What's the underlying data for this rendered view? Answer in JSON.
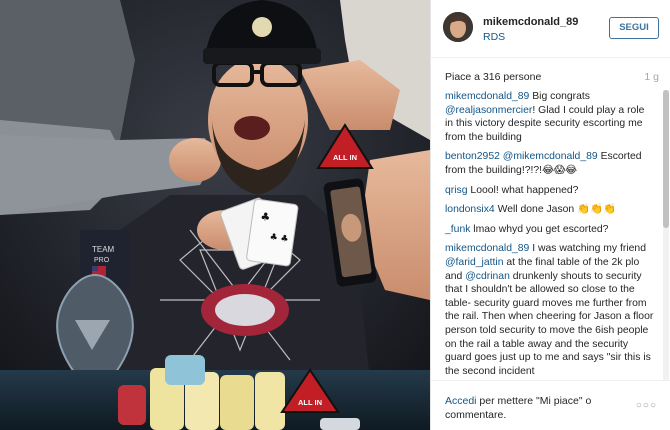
{
  "post": {
    "username": "mikemcdonald_89",
    "location": "RDS",
    "follow_label": "SEGUI",
    "likes_text": "Piace a 316 persone",
    "time_ago": "1 g",
    "photo_labels": {
      "all_in_1": "ALL IN",
      "all_in_2": "ALL IN",
      "team": "TEAM",
      "team_2": "PRO"
    }
  },
  "comments": [
    {
      "author": "mikemcdonald_89",
      "parts": [
        " Big congrats ",
        "@realjasonmercier",
        "! Glad I could play a role in this victory despite security escorting me from the building"
      ]
    },
    {
      "author": "benton2952",
      "parts": [
        " ",
        "@mikemcdonald_89",
        " Escorted from the building!?!?!😂😱😂"
      ]
    },
    {
      "author": "qrisg",
      "parts": [
        " Loool! what happened?"
      ]
    },
    {
      "author": "londonsix4",
      "parts": [
        " Well done Jason 👏👏👏"
      ]
    },
    {
      "author": "_funk",
      "parts": [
        " lmao whyd you get escorted?"
      ]
    },
    {
      "author": "mikemcdonald_89",
      "parts": [
        " I was watching my friend ",
        "@farid_jattin",
        " at the final table of the 2k plo and ",
        "@cdrinan",
        " drunkenly shouts to security that I shouldn't be allowed so close to the table- security guard moves me further from the rail. Then when cheering for Jason a floor person told security to move the 6ish people on the rail a table away and the security guard goes just up to me and says \"sir this is the second incident"
      ]
    }
  ],
  "footer": {
    "login_link": "Accedi",
    "rest": " per mettere \"Mi piace\" o commentare.",
    "more": "○○○"
  },
  "colors": {
    "link": "#125688",
    "follow_border": "#3f729b",
    "muted": "#a5a7aa"
  }
}
